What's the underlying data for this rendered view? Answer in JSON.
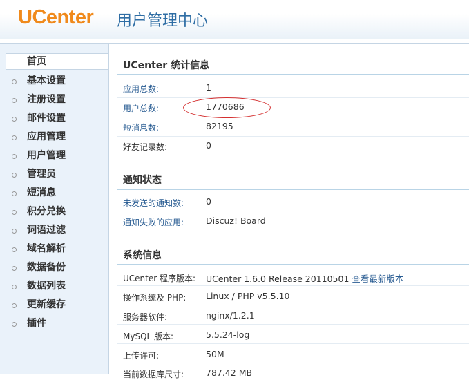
{
  "header": {
    "logo": "UCenter",
    "title": "用户管理中心"
  },
  "sidebar": {
    "items": [
      {
        "label": "首页",
        "active": true
      },
      {
        "label": "基本设置"
      },
      {
        "label": "注册设置"
      },
      {
        "label": "邮件设置"
      },
      {
        "label": "应用管理"
      },
      {
        "label": "用户管理"
      },
      {
        "label": "管理员"
      },
      {
        "label": "短消息"
      },
      {
        "label": "积分兑换"
      },
      {
        "label": "词语过滤"
      },
      {
        "label": "域名解析"
      },
      {
        "label": "数据备份"
      },
      {
        "label": "数据列表"
      },
      {
        "label": "更新缓存"
      },
      {
        "label": "插件"
      }
    ]
  },
  "stats": {
    "title": "UCenter 统计信息",
    "rows": [
      {
        "label": "应用总数:",
        "value": "1"
      },
      {
        "label": "用户总数:",
        "value": "1770686"
      },
      {
        "label": "短消息数:",
        "value": "82195"
      },
      {
        "label": "好友记录数:",
        "value": "0"
      }
    ]
  },
  "notify": {
    "title": "通知状态",
    "rows": [
      {
        "label": "未发送的通知数:",
        "value": "0"
      },
      {
        "label": "通知失败的应用:",
        "value": "Discuz! Board"
      }
    ]
  },
  "system": {
    "title": "系统信息",
    "rows": [
      {
        "label": "UCenter 程序版本:",
        "value": "UCenter 1.6.0 Release 20110501",
        "link": "查看最新版本"
      },
      {
        "label": "操作系统及 PHP:",
        "value": "Linux / PHP v5.5.10"
      },
      {
        "label": "服务器软件:",
        "value": "nginx/1.2.1"
      },
      {
        "label": "MySQL 版本:",
        "value": "5.5.24-log"
      },
      {
        "label": "上传许可:",
        "value": "50M"
      },
      {
        "label": "当前数据库尺寸:",
        "value": "787.42 MB"
      }
    ]
  },
  "colors": {
    "logo": "#f08a1c",
    "title": "#2e6da4",
    "link": "#2a5d93",
    "annotation": "#d43030"
  }
}
